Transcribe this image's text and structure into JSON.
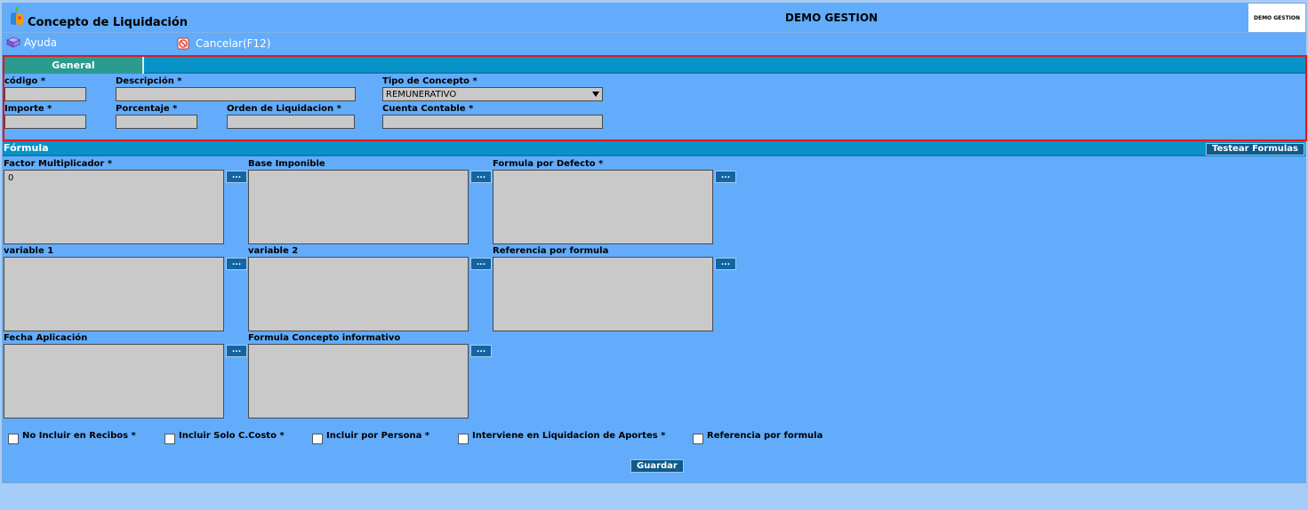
{
  "header": {
    "title": "Concepto de Liquidación",
    "company": "DEMO GESTION",
    "brand_text": "DEMO GESTION"
  },
  "menu": {
    "help_label": "Ayuda",
    "cancel_label": "Cancelar(F12)"
  },
  "general": {
    "tab_label": "General",
    "codigo_label": "código *",
    "descripcion_label": "Descripción *",
    "tipo_label": "Tipo de Concepto *",
    "tipo_value": "REMUNERATIVO",
    "importe_label": "Importe *",
    "porcentaje_label": "Porcentaje *",
    "orden_label": "Orden de Liquidacion *",
    "cuenta_label": "Cuenta Contable *"
  },
  "formula": {
    "section_title": "Fórmula",
    "test_button": "Testear Formulas",
    "dots_label": "...",
    "factor_label": "Factor Multiplicador *",
    "factor_value": "0",
    "base_label": "Base Imponible",
    "defecto_label": "Formula por Defecto *",
    "var1_label": "variable 1",
    "var2_label": "variable 2",
    "referencia_label": "Referencia por formula",
    "fecha_label": "Fecha Aplicación",
    "informativo_label": "Formula Concepto informativo"
  },
  "checks": {
    "no_incluir": "No Incluir en Recibos *",
    "solo_ccosto": "Incluir Solo C.Costo *",
    "por_persona": "Incluir por Persona *",
    "aportes": "Interviene en Liquidacion de Aportes *",
    "referencia": "Referencia por formula"
  },
  "footer": {
    "save_label": "Guardar"
  },
  "colors": {
    "background": "#62acfb",
    "section_bar": "#0893c8",
    "tab": "#2a9b8f",
    "highlight_border": "#e8141b",
    "button": "#0d5a8c"
  }
}
